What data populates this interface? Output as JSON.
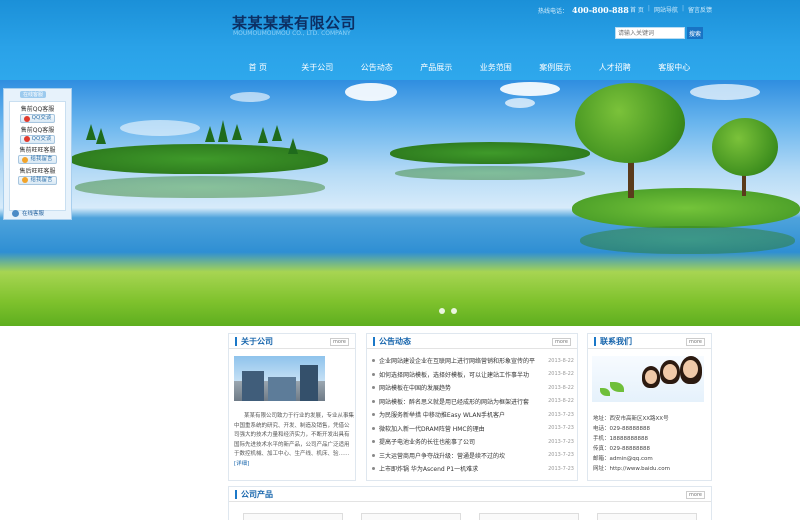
{
  "header": {
    "logo": "某某某某有限公司",
    "logo_sub": "MOUMOUMOUMOU CO., LTD. COMPANY",
    "hotline_label": "热线电话：",
    "hotline_number": "400-800-888",
    "top_links": [
      "首 页",
      "网站导航",
      "留言反馈"
    ],
    "search_placeholder": "请输入关键词",
    "search_button": "搜索"
  },
  "nav": [
    "首 页",
    "关于公司",
    "公告动态",
    "产品展示",
    "业务范围",
    "案例展示",
    "人才招聘",
    "客服中心"
  ],
  "service": {
    "tag": "在线客服",
    "items": [
      {
        "label": "售前QQ客服",
        "button": "QQ交谈",
        "type": "qq"
      },
      {
        "label": "售前QQ客服",
        "button": "QQ交谈",
        "type": "qq"
      },
      {
        "label": "售前旺旺客服",
        "button": "给我留言",
        "type": "ww"
      },
      {
        "label": "售后旺旺客服",
        "button": "给我留言",
        "type": "ww"
      }
    ],
    "footer": "在线客服"
  },
  "about": {
    "title": "关于公司",
    "more": "more",
    "text": "某某有限公司致力于行业的发展，专业从事集中国重系统的研究、开发、制造及销售，凭借公司强大的技术力量和经济实力，不断开发出具有国际先进技术水平的新产品，公司产品广泛适用于数控机械、加工中心、生产线、机床、验……",
    "more_link": "[详细]"
  },
  "news": {
    "title": "公告动态",
    "more": "more",
    "items": [
      {
        "title": "企业网站建设企业在互联网上进行网络营销和形象宣传的平",
        "date": "2013-8-22"
      },
      {
        "title": "如何选择网站模板，选择好模板，可以让建站工作事半功",
        "date": "2013-8-22"
      },
      {
        "title": "网站模板在中国的发展趋势",
        "date": "2013-8-22"
      },
      {
        "title": "网站模板：醉名思义就是用已经成形的网站为框架进行套",
        "date": "2013-8-22"
      },
      {
        "title": "为民服务新举措 中移动推Easy WLAN手机客户",
        "date": "2013-7-23"
      },
      {
        "title": "微软加入新一代DRAM阵营 HMC的理由",
        "date": "2013-7-23"
      },
      {
        "title": "提高子电池业务的长往也能事了公司",
        "date": "2013-7-23"
      },
      {
        "title": "三大运营商用户争夺战升级：营通是续不过的坎",
        "date": "2013-7-23"
      },
      {
        "title": "上市即炸锅 华为Ascend P1一机难求",
        "date": "2013-7-23"
      }
    ]
  },
  "contact": {
    "title": "联系我们",
    "more": "more",
    "lines": [
      "地址：西安市高新区XX路XX号",
      "电话：029-88888888",
      "手机：18888888888",
      "传真：029-88888888",
      "邮箱：admin@qq.com",
      "网址：http://www.baidu.com"
    ]
  },
  "products": {
    "title": "公司产品",
    "more": "more"
  },
  "colors": {
    "header": "#2aa2e8",
    "accent": "#1866ad",
    "logo": "#0c2f63"
  }
}
